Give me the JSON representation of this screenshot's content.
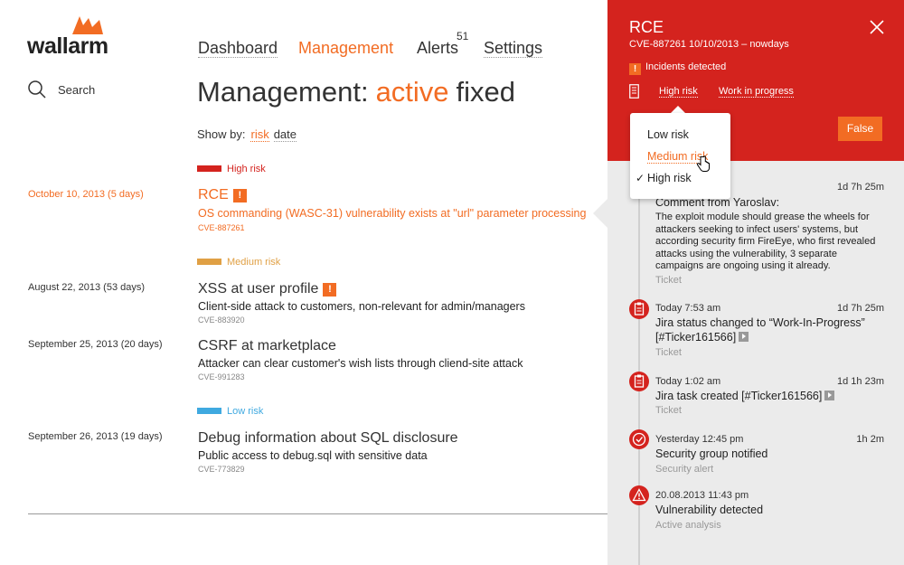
{
  "brand": {
    "name": "wallarm",
    "accent": "#f26c23",
    "red": "#d4231e"
  },
  "nav": {
    "items": [
      {
        "label": "Dashboard",
        "active": false
      },
      {
        "label": "Management",
        "active": true
      },
      {
        "label": "Alerts",
        "active": false
      },
      {
        "label": "Settings",
        "active": false
      }
    ],
    "alerts_count": "51"
  },
  "search": {
    "label": "Search",
    "icon": "search-icon"
  },
  "page": {
    "title": "Management:",
    "tab_active": "active",
    "tab_fixed": "fixed",
    "show_by_label": "Show by:",
    "show_by_risk": "risk",
    "show_by_date": "date"
  },
  "groups": {
    "high": {
      "label": "High risk",
      "color": "#d4231e"
    },
    "medium": {
      "label": "Medium risk",
      "color": "#e0a044"
    },
    "low": {
      "label": "Low risk",
      "color": "#3fa9e0"
    }
  },
  "vulns": [
    {
      "date": "October 10, 2013 (5 days)",
      "title": "RCE",
      "desc": "OS commanding (WASC-31) vulnerability exists at \"url\" parameter processing",
      "cve": "CVE-887261",
      "flag": "!"
    },
    {
      "date": "August 22, 2013 (53 days)",
      "title": "XSS at user profile",
      "desc": "Client-side attack to customers, non-relevant for admin/managers",
      "cve": "CVE-883920",
      "flag": "!"
    },
    {
      "date": "September 25, 2013 (20 days)",
      "title": "CSRF at marketplace",
      "desc": "Attacker can clear customer's wish lists through cliend-site attack",
      "cve": "CVE-991283"
    },
    {
      "date": "September 26, 2013 (19 days)",
      "title": "Debug information about SQL disclosure",
      "desc": "Public access to debug.sql with sensitive data",
      "cve": "CVE-773829"
    }
  ],
  "panel": {
    "title": "RCE",
    "subtitle": "CVE-887261   10/10/2013 – nowdays",
    "incidents": "Incidents detected",
    "incidents_flag": "!",
    "risk_link": "High risk",
    "status_link": "Work in progress",
    "false_button": "False",
    "dropdown": {
      "items": [
        "Low risk",
        "Medium risk",
        "High risk"
      ],
      "check": "✓"
    },
    "timeline": [
      {
        "ago": "1d 7h 25m",
        "title": "Comment from Yaroslav:",
        "body": "The exploit module should grease the wheels for attackers seeking to infect users' systems, but according security firm FireEye, who first revealed attacks using the vulnerability, 3 separate campaigns are ongoing using it already.",
        "tag": "Ticket"
      },
      {
        "time": "Today 7:53 am",
        "ago": "1d 7h 25m",
        "title": "Jira status changed to “Work-In-Progress”",
        "title2": "[#Ticker161566]",
        "tag": "Ticket",
        "icon": "clipboard-icon"
      },
      {
        "time": "Today 1:02 am",
        "ago": "1d 1h 23m",
        "title": "Jira task created [#Ticker161566]",
        "tag": "Ticket",
        "icon": "clipboard-icon"
      },
      {
        "time": "Yesterday 12:45 pm",
        "ago": "1h 2m",
        "title": "Security group notified",
        "tag": "Security alert",
        "icon": "check-circle-icon"
      },
      {
        "time": "20.08.2013 11:43 pm",
        "title": "Vulnerability detected",
        "tag": "Active analysis",
        "icon": "warning-icon"
      }
    ]
  }
}
